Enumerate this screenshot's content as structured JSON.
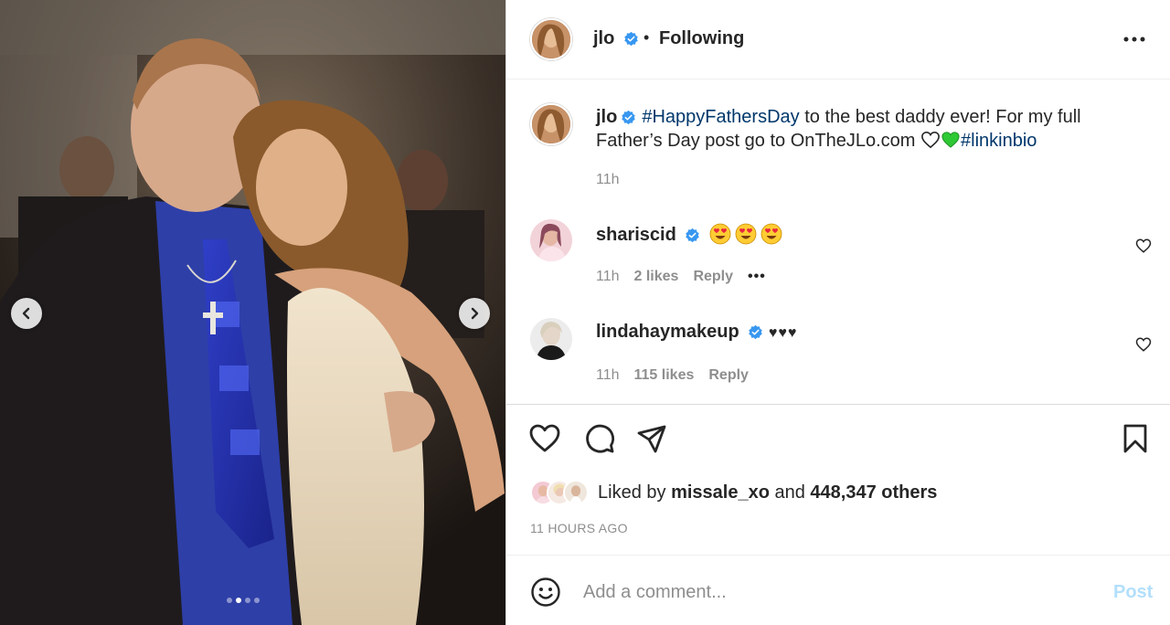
{
  "media": {
    "prev_icon": "chevron-left-icon",
    "next_icon": "chevron-right-icon",
    "carousel_total": 4,
    "carousel_active": 2
  },
  "header": {
    "username": "jlo",
    "verified_icon": "verified-badge-icon",
    "separator": "•",
    "follow_status": "Following",
    "more_icon": "more-horizontal-icon"
  },
  "caption": {
    "username": "jlo",
    "hashtag1": "#HappyFathersDay",
    "text1": " to the best daddy ever! For my full Father’s Day post go to OnTheJLo.com ",
    "hashtag2": "#linkinbio",
    "time": "11h"
  },
  "comments": [
    {
      "username": "shariscid",
      "text": "",
      "emoji_icon": "heart-eyes-emoji-icon",
      "emoji_count": 3,
      "time": "11h",
      "likes": "2 likes",
      "reply": "Reply",
      "more": "•••"
    },
    {
      "username": "lindahaymakeup",
      "text": "♥♥♥",
      "time": "11h",
      "likes": "115 likes",
      "reply": "Reply"
    }
  ],
  "actions": {
    "like_icon": "heart-icon",
    "comment_icon": "comment-icon",
    "share_icon": "send-icon",
    "save_icon": "bookmark-icon",
    "liked_by_prefix": "Liked by ",
    "liked_by_user": "missale_xo",
    "liked_by_middle": " and ",
    "liked_by_others": "448,347 others",
    "timestamp": "11 HOURS AGO"
  },
  "add_comment": {
    "placeholder": "Add a comment...",
    "post_label": "Post"
  },
  "colors": {
    "link": "#00376b",
    "muted": "#8e8e8e",
    "verified": "#3897f0",
    "post_disabled": "#b2dffc"
  }
}
